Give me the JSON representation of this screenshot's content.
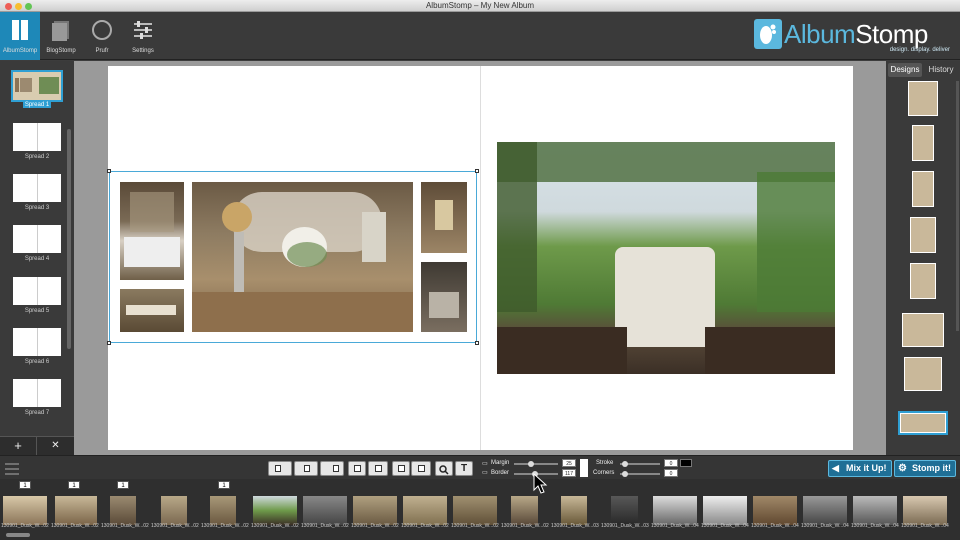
{
  "window": {
    "title": "AlbumStomp – My New Album"
  },
  "toolbar": {
    "tools": [
      {
        "label": "AlbumStomp",
        "icon": "book-icon",
        "active": true
      },
      {
        "label": "BlogStomp",
        "icon": "blog-icon",
        "active": false
      },
      {
        "label": "Prufr",
        "icon": "circle-icon",
        "active": false
      },
      {
        "label": "Settings",
        "icon": "sliders-icon",
        "active": false
      }
    ],
    "brand": {
      "name_part1": "Album",
      "name_part2": "Stomp",
      "tagline": "design. display. deliver"
    }
  },
  "left_panel": {
    "spreads": [
      "Spread 1",
      "Spread 2",
      "Spread 3",
      "Spread 4",
      "Spread 5",
      "Spread 6",
      "Spread 7"
    ],
    "active_spread": 0,
    "add_label": "+",
    "remove_label": "✕"
  },
  "right_panel": {
    "tabs": [
      "Designs",
      "History"
    ],
    "active_tab": 0
  },
  "bottom_bar": {
    "margin_label": "Margin",
    "margin_value": "25",
    "border_label": "Border",
    "border_value": "117",
    "stroke_label": "Stroke",
    "stroke_value": "0",
    "corners_label": "Corners",
    "corners_value": "0",
    "mix_button": "Mix it Up!",
    "stomp_button": "Stomp it!",
    "text_tool": "T"
  },
  "filmstrip": {
    "usage_counts": [
      "1",
      "1",
      "1",
      "1"
    ],
    "filenames": [
      "130901_Dusk_W...02",
      "130901_Dusk_W...02",
      "130901_Dusk_W...02",
      "130901_Dusk_W...02",
      "130901_Dusk_W...02",
      "130901_Dusk_W...02",
      "130901_Dusk_W...02",
      "130901_Dusk_W...02",
      "130901_Dusk_W...02",
      "130901_Dusk_W...02",
      "130901_Dusk_W...02",
      "130901_Dusk_W...03",
      "130901_Dusk_W...03",
      "130901_Dusk_W...04",
      "130901_Dusk_W...04",
      "130901_Dusk_W...04",
      "130901_Dusk_W...04",
      "130901_Dusk_W...04",
      "130901_Dusk_W...04"
    ]
  },
  "colors": {
    "accent": "#2f9fd3",
    "toolbar": "#3a3a3a",
    "canvas": "#9a9a9a",
    "brand_blue": "#5bb8de"
  }
}
